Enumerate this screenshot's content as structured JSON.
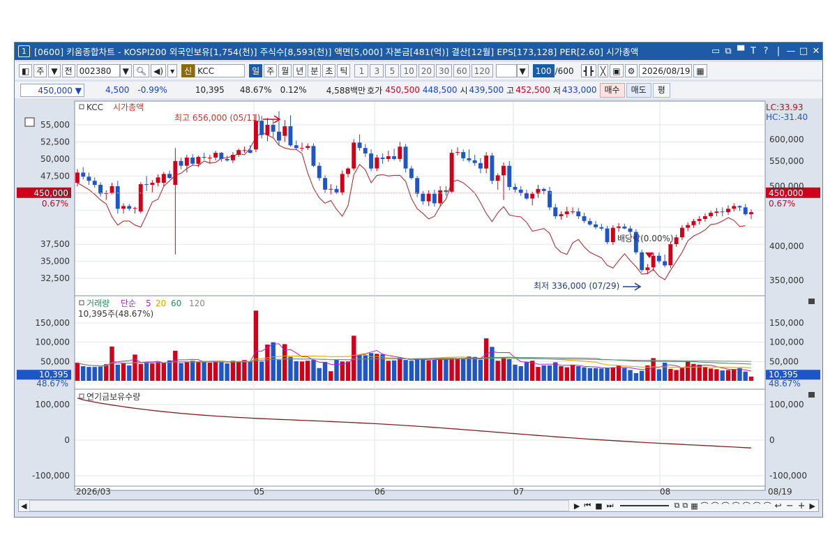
{
  "window": {
    "number": "1",
    "title": "[0600] 키움종합차트 - KOSPI200 외국인보유[1,754(천)] 주식수[8,593(천)] 액면[5,000] 자본금[481(억)] 결산[12월] EPS[173,128] PER[2.60] 시가총액"
  },
  "toolbar": {
    "market": "주",
    "prev": "전",
    "code": "002380",
    "credit": "신",
    "name": "KCC",
    "periods": [
      "일",
      "주",
      "월",
      "년",
      "분",
      "초",
      "틱"
    ],
    "selected_period": "일",
    "intervals": [
      "1",
      "3",
      "5",
      "10",
      "20",
      "30",
      "60",
      "120"
    ],
    "count_value": "100",
    "count_total": "/600",
    "date": "2026/08/19"
  },
  "infobar": {
    "price": "450,000",
    "change": "4,500",
    "change_pct": "-0.99%",
    "volume": "10,395",
    "volume_ratio": "48.67%",
    "turnover": "0.12%",
    "amount": "4,588백만",
    "ask_label": "호가",
    "ask": "450,500",
    "bid": "448,500",
    "open_label": "시",
    "open": "439,500",
    "high_label": "고",
    "high": "452,500",
    "low_label": "저",
    "low": "433,000",
    "buy_button": "매수",
    "sell_button": "매도",
    "eval_button": "평"
  },
  "price_panel": {
    "legend_name": "KCC",
    "legend_series": "시가총액",
    "left_axis": [
      "55,000",
      "52,500",
      "50,000",
      "47,500",
      "45,000",
      "42,500",
      "40,000",
      "37,500",
      "35,000",
      "32,500"
    ],
    "right_axis": [
      "600,000",
      "550,000",
      "500,000",
      "400,000",
      "350,000"
    ],
    "lc": "LC:33.93",
    "hc": "HC:-31.40",
    "cur_left": "450,000",
    "cur_left_pct": "0.67%",
    "cur_right": "450,000",
    "cur_right_pct": "0.67%",
    "high_note": "최고 656,000 (05/11)",
    "low_note": "최저 336,000 (07/29)",
    "dividend_note": "배당락(0.00%)"
  },
  "volume_panel": {
    "legend_vol": "거래량",
    "legend_ma": "단순",
    "ma_periods": [
      "5",
      "20",
      "60",
      "120"
    ],
    "last_text": "10,395주(48.67%)",
    "left_axis": [
      "150,000",
      "100,000",
      "50,000"
    ],
    "right_axis": [
      "150,000",
      "100,000",
      "50,000"
    ],
    "cur_left": "10,395",
    "cur_left_pct": "48.67%",
    "cur_right": "10,395",
    "cur_right_pct": "48.67%"
  },
  "pension_panel": {
    "legend": "연기금보유수량",
    "left_axis": [
      "100,000",
      "0",
      "-100,000"
    ],
    "right_axis": [
      "100,000",
      "0",
      "-100,000"
    ]
  },
  "xaxis": {
    "labels": [
      "2026/03",
      "05",
      "06",
      "07",
      "08"
    ],
    "right_label": "08/19"
  },
  "colors": {
    "up": "#d0021b",
    "down": "#1e56c8",
    "title_bg": "#1d5ba6",
    "ma5": "#b022c8",
    "ma20": "#e0a000",
    "ma60": "#2e8b57",
    "ma120": "#888888",
    "pension": "#7a2020"
  },
  "chart_data": {
    "type": "candlestick",
    "candles": [
      [
        46.5,
        48.5,
        46.0,
        48.0
      ],
      [
        48.0,
        48.8,
        47.0,
        47.4
      ],
      [
        47.4,
        48.0,
        46.2,
        46.8
      ],
      [
        46.8,
        47.3,
        45.8,
        46.2
      ],
      [
        46.2,
        46.6,
        44.5,
        44.9
      ],
      [
        44.9,
        45.4,
        44.0,
        45.0
      ],
      [
        45.0,
        46.5,
        44.8,
        46.0
      ],
      [
        46.0,
        46.8,
        42.0,
        42.7
      ],
      [
        42.7,
        43.5,
        42.0,
        43.1
      ],
      [
        43.1,
        43.4,
        42.4,
        42.7
      ],
      [
        42.7,
        43.0,
        42.0,
        42.8
      ],
      [
        42.3,
        46.6,
        42.0,
        46.3
      ],
      [
        46.3,
        47.5,
        45.3,
        46.2
      ],
      [
        46.2,
        46.9,
        45.1,
        46.5
      ],
      [
        46.5,
        47.7,
        46.0,
        47.3
      ],
      [
        46.5,
        48.1,
        46.0,
        47.8
      ],
      [
        47.8,
        48.3,
        47.1,
        47.2
      ],
      [
        46.2,
        51.6,
        36.0,
        49.7
      ],
      [
        49.7,
        50.2,
        48.5,
        49.0
      ],
      [
        49.0,
        50.6,
        48.0,
        50.2
      ],
      [
        50.2,
        50.7,
        49.0,
        49.3
      ],
      [
        49.3,
        50.5,
        48.8,
        50.3
      ],
      [
        50.3,
        50.9,
        49.9,
        50.2
      ],
      [
        50.2,
        50.6,
        49.3,
        50.2
      ],
      [
        50.2,
        51.2,
        49.8,
        50.9
      ],
      [
        50.9,
        51.0,
        49.6,
        50.0
      ],
      [
        50.0,
        50.5,
        49.6,
        49.8
      ],
      [
        49.8,
        51.0,
        49.4,
        50.6
      ],
      [
        50.6,
        51.5,
        50.3,
        51.3
      ],
      [
        51.3,
        51.8,
        50.9,
        51.3
      ],
      [
        51.3,
        52.0,
        50.8,
        50.9
      ],
      [
        51.4,
        56.6,
        51.0,
        55.6
      ],
      [
        55.6,
        56.3,
        53.0,
        53.5
      ],
      [
        53.5,
        56.0,
        52.6,
        55.0
      ],
      [
        55.0,
        55.8,
        53.2,
        54.0
      ],
      [
        54.0,
        57.0,
        52.0,
        52.7
      ],
      [
        53.4,
        55.7,
        52.5,
        54.8
      ],
      [
        54.8,
        56.4,
        51.8,
        52.0
      ],
      [
        52.0,
        52.7,
        51.3,
        51.6
      ],
      [
        51.6,
        52.4,
        51.1,
        51.6
      ],
      [
        51.6,
        52.3,
        51.3,
        51.9
      ],
      [
        51.9,
        52.3,
        48.8,
        49.0
      ],
      [
        49.0,
        49.5,
        46.8,
        47.2
      ],
      [
        47.2,
        47.6,
        45.0,
        45.5
      ],
      [
        45.5,
        46.3,
        44.8,
        45.6
      ],
      [
        45.6,
        46.1,
        44.9,
        45.1
      ],
      [
        45.1,
        48.3,
        44.7,
        47.8
      ],
      [
        47.8,
        48.8,
        47.3,
        48.6
      ],
      [
        48.6,
        52.9,
        48.3,
        52.4
      ],
      [
        52.4,
        53.6,
        51.2,
        51.6
      ],
      [
        51.6,
        52.2,
        50.3,
        50.8
      ],
      [
        50.8,
        51.4,
        48.2,
        48.6
      ],
      [
        48.6,
        50.6,
        48.2,
        50.2
      ],
      [
        50.2,
        50.8,
        49.3,
        50.0
      ],
      [
        50.0,
        51.2,
        49.6,
        50.4
      ],
      [
        50.4,
        51.5,
        49.8,
        50.0
      ],
      [
        50.0,
        52.5,
        49.6,
        51.8
      ],
      [
        51.8,
        52.2,
        48.0,
        48.6
      ],
      [
        48.6,
        49.0,
        47.0,
        47.2
      ],
      [
        47.2,
        47.5,
        44.4,
        44.9
      ],
      [
        44.9,
        45.3,
        43.3,
        43.8
      ],
      [
        43.8,
        45.4,
        43.1,
        44.9
      ],
      [
        44.9,
        45.5,
        43.0,
        43.5
      ],
      [
        43.5,
        46.0,
        43.0,
        45.4
      ],
      [
        45.4,
        46.0,
        44.6,
        45.2
      ],
      [
        45.2,
        51.4,
        45.0,
        50.9
      ],
      [
        50.9,
        51.7,
        50.5,
        51.0
      ],
      [
        51.0,
        51.4,
        49.7,
        50.1
      ],
      [
        50.1,
        51.4,
        49.5,
        49.8
      ],
      [
        49.8,
        50.6,
        49.0,
        49.4
      ],
      [
        49.4,
        50.1,
        47.9,
        48.6
      ],
      [
        48.6,
        51.0,
        47.9,
        50.5
      ],
      [
        50.5,
        50.9,
        46.3,
        46.8
      ],
      [
        46.8,
        47.9,
        45.5,
        47.6
      ],
      [
        47.6,
        49.5,
        44.0,
        49.0
      ],
      [
        49.0,
        49.7,
        45.4,
        45.9
      ],
      [
        45.9,
        46.4,
        45.1,
        45.5
      ],
      [
        45.5,
        46.0,
        44.6,
        45.0
      ],
      [
        45.0,
        45.5,
        44.0,
        44.2
      ],
      [
        44.2,
        45.2,
        43.2,
        44.9
      ],
      [
        44.9,
        46.2,
        44.3,
        45.6
      ],
      [
        45.6,
        45.8,
        44.8,
        45.3
      ],
      [
        45.3,
        45.9,
        42.5,
        42.9
      ],
      [
        42.9,
        43.4,
        41.2,
        41.6
      ],
      [
        41.6,
        42.3,
        41.1,
        41.9
      ],
      [
        41.9,
        43.0,
        41.4,
        42.3
      ],
      [
        42.3,
        42.9,
        41.9,
        42.3
      ],
      [
        42.3,
        42.8,
        41.2,
        41.6
      ],
      [
        41.6,
        42.1,
        40.6,
        40.9
      ],
      [
        40.9,
        41.3,
        40.2,
        40.4
      ],
      [
        40.4,
        40.9,
        39.7,
        40.0
      ],
      [
        40.0,
        40.5,
        39.5,
        39.8
      ],
      [
        39.8,
        40.2,
        37.5,
        37.8
      ],
      [
        37.8,
        40.3,
        37.4,
        39.9
      ],
      [
        39.9,
        40.6,
        39.3,
        40.1
      ],
      [
        40.1,
        40.5,
        39.7,
        39.8
      ],
      [
        39.8,
        40.2,
        38.9,
        39.3
      ],
      [
        39.3,
        39.7,
        36.0,
        36.3
      ],
      [
        36.3,
        36.7,
        33.4,
        33.7
      ],
      [
        33.7,
        34.6,
        33.1,
        34.1
      ],
      [
        34.1,
        36.2,
        33.6,
        35.8
      ],
      [
        35.8,
        36.3,
        34.7,
        35.0
      ],
      [
        35.0,
        36.0,
        34.1,
        34.4
      ],
      [
        34.4,
        37.9,
        34.0,
        37.5
      ],
      [
        37.5,
        38.9,
        37.1,
        38.5
      ],
      [
        38.5,
        40.3,
        38.1,
        39.9
      ],
      [
        39.9,
        40.7,
        39.4,
        40.3
      ],
      [
        40.3,
        41.2,
        39.9,
        40.9
      ],
      [
        40.9,
        41.6,
        40.4,
        41.2
      ],
      [
        41.2,
        42.0,
        40.8,
        41.6
      ],
      [
        41.6,
        42.4,
        41.3,
        42.1
      ],
      [
        42.1,
        42.8,
        41.6,
        42.3
      ],
      [
        42.3,
        42.9,
        41.6,
        42.2
      ],
      [
        42.2,
        43.2,
        41.8,
        42.7
      ],
      [
        42.7,
        43.5,
        42.3,
        43.1
      ],
      [
        43.1,
        43.2,
        42.4,
        42.9
      ],
      [
        42.9,
        43.4,
        41.7,
        41.9
      ],
      [
        41.9,
        42.6,
        41.2,
        42.2
      ]
    ],
    "market_cap": [
      46.5,
      46.0,
      45.5,
      44.8,
      44.0,
      43.4,
      41.5,
      40.3,
      40.9,
      40.9,
      40.3,
      40.0,
      41.8,
      43.7,
      44.1,
      46.0,
      46.8,
      47.6,
      47.9,
      48.6,
      49.1,
      49.0,
      49.7,
      49.4,
      49.5,
      50.1,
      50.2,
      50.4,
      50.8,
      50.6,
      51.6,
      53.2,
      53.9,
      53.5,
      53.1,
      52.0,
      51.6,
      51.4,
      51.4,
      50.8,
      47.9,
      45.7,
      44.3,
      43.5,
      43.9,
      42.6,
      41.6,
      43.2,
      47.7,
      49.2,
      48.4,
      46.5,
      47.6,
      47.7,
      47.5,
      47.6,
      47.6,
      46.7,
      44.2,
      42.7,
      42.0,
      41.2,
      41.6,
      43.1,
      44.1,
      46.6,
      46.9,
      46.5,
      45.8,
      45.0,
      43.6,
      42.0,
      40.8,
      42.1,
      43.0,
      41.8,
      41.6,
      41.5,
      40.7,
      39.4,
      39.6,
      39.8,
      39.1,
      37.1,
      36.3,
      36.0,
      37.7,
      38.2,
      37.1,
      36.3,
      35.9,
      35.5,
      34.4,
      34.0,
      35.1,
      36.1,
      35.1,
      34.2,
      33.1,
      33.2,
      33.8,
      32.8,
      32.3,
      33.7,
      35.0,
      36.3,
      38.0,
      38.7,
      39.1,
      39.6,
      40.4,
      40.5,
      40.9,
      41.4,
      41.0,
      40.1,
      40.2
    ],
    "volume": [
      47,
      38,
      36,
      36,
      37,
      43,
      89,
      42,
      45,
      40,
      68,
      44,
      47,
      45,
      49,
      46,
      53,
      78,
      46,
      49,
      52,
      48,
      51,
      47,
      50,
      49,
      45,
      52,
      48,
      54,
      50,
      182,
      50,
      94,
      100,
      54,
      95,
      62,
      51,
      50,
      52,
      54,
      33,
      49,
      25,
      55,
      50,
      50,
      117,
      68,
      66,
      72,
      70,
      69,
      52,
      53,
      60,
      54,
      52,
      58,
      55,
      53,
      55,
      57,
      56,
      58,
      57,
      56,
      63,
      62,
      55,
      110,
      88,
      52,
      60,
      56,
      42,
      38,
      48,
      52,
      36,
      40,
      40,
      48,
      38,
      35,
      42,
      38,
      35,
      33,
      33,
      32,
      33,
      35,
      40,
      33,
      28,
      20,
      26,
      40,
      59,
      30,
      47,
      31,
      28,
      33,
      50,
      44,
      42,
      35,
      32,
      30,
      27,
      28,
      30,
      33,
      24,
      11
    ],
    "ylim": [
      30000,
      57500
    ],
    "xlabels": [
      "2026/03",
      "05",
      "06",
      "07",
      "08"
    ]
  }
}
